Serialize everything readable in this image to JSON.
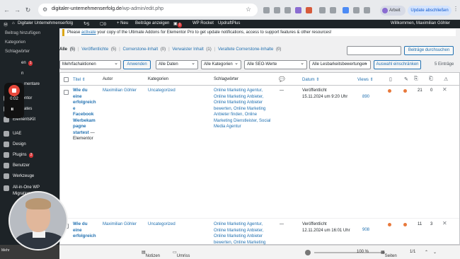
{
  "browser": {
    "url_host": "digitaler-unternehmenserfolg.de",
    "url_path": "/wp-admin/edit.php",
    "profile_label": "Arbeit",
    "update_label": "Update abschließen"
  },
  "adminbar": {
    "site_name": "Digitaler Unternehmenserfolg",
    "updates_count": "5",
    "comments_count": "0",
    "new_label": "+ Neu",
    "view_posts": "Beiträge anzeigen",
    "yoast_badge": "1",
    "wp_rocket": "WP Rocket",
    "updraft": "UpdraftPlus",
    "greeting": "Willkommen, Maximilian Göhler"
  },
  "sidebar": {
    "sub_items": [
      "Beitrag hinzufügen",
      "Kategorien",
      "Schlagwörter"
    ],
    "partial_items": [
      "en",
      "n",
      "mentare"
    ],
    "partial_badge": "1",
    "recorder_time": "0:02",
    "items": [
      {
        "label": "Elementor"
      },
      {
        "label": "Templates"
      },
      {
        "label": "ElementsKit"
      },
      {
        "label": "UAE"
      },
      {
        "label": "Design"
      },
      {
        "label": "Plugins",
        "badge": "2"
      },
      {
        "label": "Benutzer"
      },
      {
        "label": "Werkzeuge"
      },
      {
        "label": "All-in-One WP Migration"
      }
    ]
  },
  "notice": {
    "pre": "Please ",
    "link": "activate",
    "post": " your copy of the Ultimate Addons for Elementor Pro to get update notifications, access to support features & other resources!"
  },
  "filters": {
    "views": [
      {
        "label": "Alle",
        "count": "(5)"
      },
      {
        "label": "Veröffentlichte",
        "count": "(5)"
      },
      {
        "label": "Cornerstone-Inhalt",
        "count": "(0)"
      },
      {
        "label": "Verwaister Inhalt",
        "count": "(1)"
      },
      {
        "label": "Veraltete Cornerstone-Inhalte",
        "count": "(0)"
      }
    ],
    "search_button": "Beiträge durchsuchen",
    "bulk_select": "Mehrfachaktionen",
    "apply_button": "Anwenden",
    "date_select": "Alle Daten",
    "category_select": "Alle Kategorien",
    "seo_select": "Alle SEO-Werte",
    "readability_select": "Alle Lesbarkeitsbewertungen",
    "filter_button": "Auswahl einschränken",
    "entries": "5 Einträge"
  },
  "table": {
    "headers": {
      "title": "Titel",
      "author": "Autor",
      "categories": "Kategorien",
      "tags": "Schlagwörter",
      "date": "Datum",
      "views": "Views"
    },
    "rows": [
      {
        "title_lines": [
          "Wie du",
          "eine",
          "erfolgreich",
          "e",
          "Facebook",
          "Werbekam",
          "pagne",
          "startest"
        ],
        "title_suffix": " — Elementor",
        "author": "Maximilian Göhler",
        "category": "Uncategorized",
        "tags": [
          "Online Marketing Agentur,",
          "Online Marketing Anbieter,",
          "Online Marketing Anbieter",
          "bewerten, Online Marketing",
          "Anbieter finden, Online",
          "Marketing Dienstleister, Social",
          "Media Agentur"
        ],
        "comments": "—",
        "status": "Veröffentlicht",
        "date": "15.11.2024 um 9:20 Uhr",
        "views": "890",
        "col_a": "21",
        "col_b": "0"
      },
      {
        "title_lines": [
          "Wie du",
          "eine",
          "erfolgreich"
        ],
        "title_suffix": "",
        "author": "Maximilian Göhler",
        "category": "Uncategorized",
        "tags": [
          "Online Marketing Agentur,",
          "Online Marketing Anbieter,",
          "Online Marketing Anbieter",
          "bewerten, Online Marketing"
        ],
        "comments": "—",
        "status": "Veröffentlicht",
        "date": "12.11.2024 um 16:01 Uhr",
        "views": "908",
        "col_a": "11",
        "col_b": "3"
      }
    ]
  },
  "bottombar": {
    "notes": "Notizen",
    "layout": "Umriss",
    "zoom": "100 %",
    "pages_label": "Seiten",
    "page": "1/1",
    "brand": "Mehr"
  }
}
